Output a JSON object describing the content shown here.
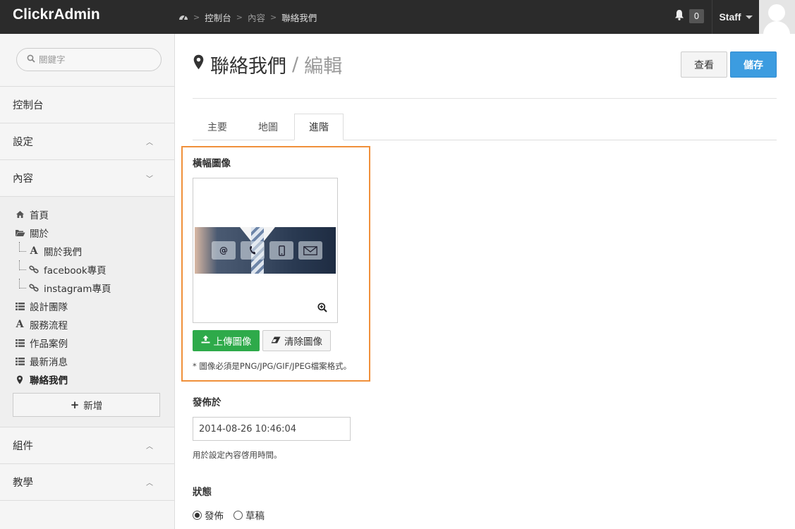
{
  "app": {
    "brand": "ClickrAdmin"
  },
  "breadcrumb": {
    "items": [
      "控制台",
      "內容",
      "聯絡我們"
    ]
  },
  "header": {
    "notification_count": "0",
    "user_label": "Staff"
  },
  "sidebar": {
    "search_placeholder": "關鍵字",
    "sections": {
      "dashboard": "控制台",
      "settings": "設定",
      "content": "內容",
      "widgets": "組件",
      "tutorial": "教學"
    },
    "content_items": [
      {
        "label": "首頁",
        "icon": "home-icon"
      },
      {
        "label": "關於",
        "icon": "folder-open-icon"
      },
      {
        "label": "關於我們",
        "icon": "font-icon"
      },
      {
        "label": "facebook專頁",
        "icon": "link-icon"
      },
      {
        "label": "instagram專頁",
        "icon": "link-icon"
      },
      {
        "label": "設計團隊",
        "icon": "list-icon"
      },
      {
        "label": "服務流程",
        "icon": "font-icon"
      },
      {
        "label": "作品案例",
        "icon": "list-icon"
      },
      {
        "label": "最新消息",
        "icon": "list-icon"
      },
      {
        "label": "聯絡我們",
        "icon": "map-marker-icon"
      }
    ],
    "add_label": "新增"
  },
  "page": {
    "title": "聯絡我們",
    "subtitle": "編輯",
    "view_button": "查看",
    "save_button": "儲存",
    "tabs": [
      "主要",
      "地圖",
      "進階"
    ],
    "active_tab": "進階"
  },
  "form": {
    "banner_label": "橫幅圖像",
    "upload_button": "上傳圖像",
    "clear_button": "清除圖像",
    "image_hint": "* 圖像必須是PNG/JPG/GIF/JPEG檔案格式。",
    "publish_label": "發佈於",
    "publish_value": "2014-08-26 10:46:04",
    "publish_hint": "用於設定內容啓用時間。",
    "status_label": "狀態",
    "status_options": [
      "發佈",
      "草稿"
    ],
    "status_selected": "發佈"
  },
  "colors": {
    "topbar": "#2b2b2b",
    "primary": "#3c9ce0",
    "success": "#2eaa4a",
    "highlight": "#f0903a"
  }
}
